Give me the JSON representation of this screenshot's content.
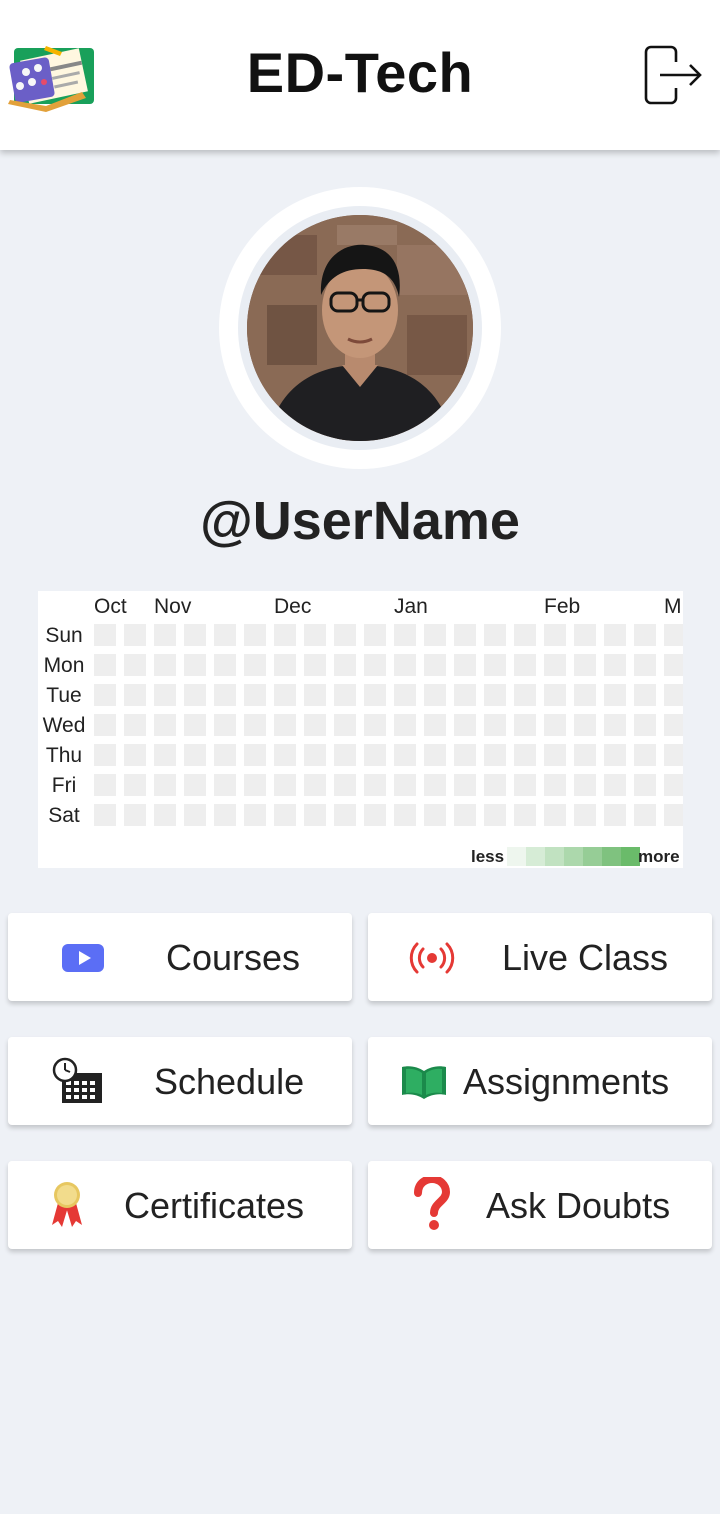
{
  "app": {
    "title": "ED-Tech"
  },
  "profile": {
    "username": "@UserName"
  },
  "activity": {
    "months": [
      "Oct",
      "Nov",
      "Dec",
      "Jan",
      "Feb",
      "M"
    ],
    "days": [
      "Sun",
      "Mon",
      "Tue",
      "Wed",
      "Thu",
      "Fri",
      "Sat"
    ],
    "legend_less": "less",
    "legend_more": "more",
    "empty_color": "#eeeeee",
    "scale_colors": [
      "#eef6ee",
      "#d6ecd6",
      "#c1e2c1",
      "#acd8ac",
      "#96cd96",
      "#7fc27f",
      "#6abb6a"
    ]
  },
  "menu": {
    "courses": "Courses",
    "live_class": "Live Class",
    "schedule": "Schedule",
    "assignments": "Assignments",
    "certificates": "Certificates",
    "ask_doubts": "Ask Doubts"
  },
  "icons": {
    "logo": "app-logo",
    "logout": "logout-icon",
    "courses": "play-video-icon",
    "live_class": "broadcast-icon",
    "schedule": "calendar-clock-icon",
    "assignments": "book-icon",
    "certificates": "award-ribbon-icon",
    "ask_doubts": "question-mark-icon"
  },
  "colors": {
    "appbar": "#ffffff",
    "background": "#eef1f6",
    "youtube_blue": "#5b6ef5",
    "live_red": "#e53935",
    "book_green": "#1b8a4b"
  }
}
